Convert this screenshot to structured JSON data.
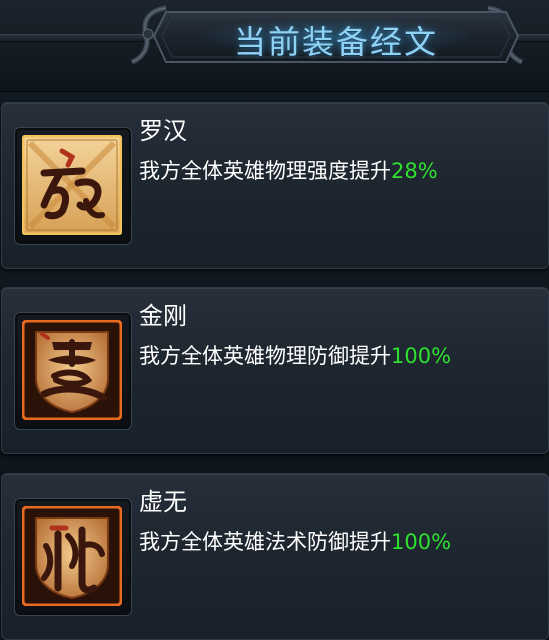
{
  "header": {
    "title": "当前装备经文"
  },
  "scriptures": [
    {
      "name": "罗汉",
      "description": "我方全体英雄物理强度提升",
      "bonus": "28%",
      "icon": "luohan-scripture-icon",
      "frame_color": "#e8b54a"
    },
    {
      "name": "金刚",
      "description": "我方全体英雄物理防御提升",
      "bonus": "100%",
      "icon": "jingang-scripture-icon",
      "frame_color": "#e86a1e"
    },
    {
      "name": "虚无",
      "description": "我方全体英雄法术防御提升",
      "bonus": "100%",
      "icon": "xuwu-scripture-icon",
      "frame_color": "#e86a1e"
    }
  ],
  "colors": {
    "title": "#8fd2f4",
    "bonus": "#2fe02f",
    "text": "#ffffff"
  }
}
